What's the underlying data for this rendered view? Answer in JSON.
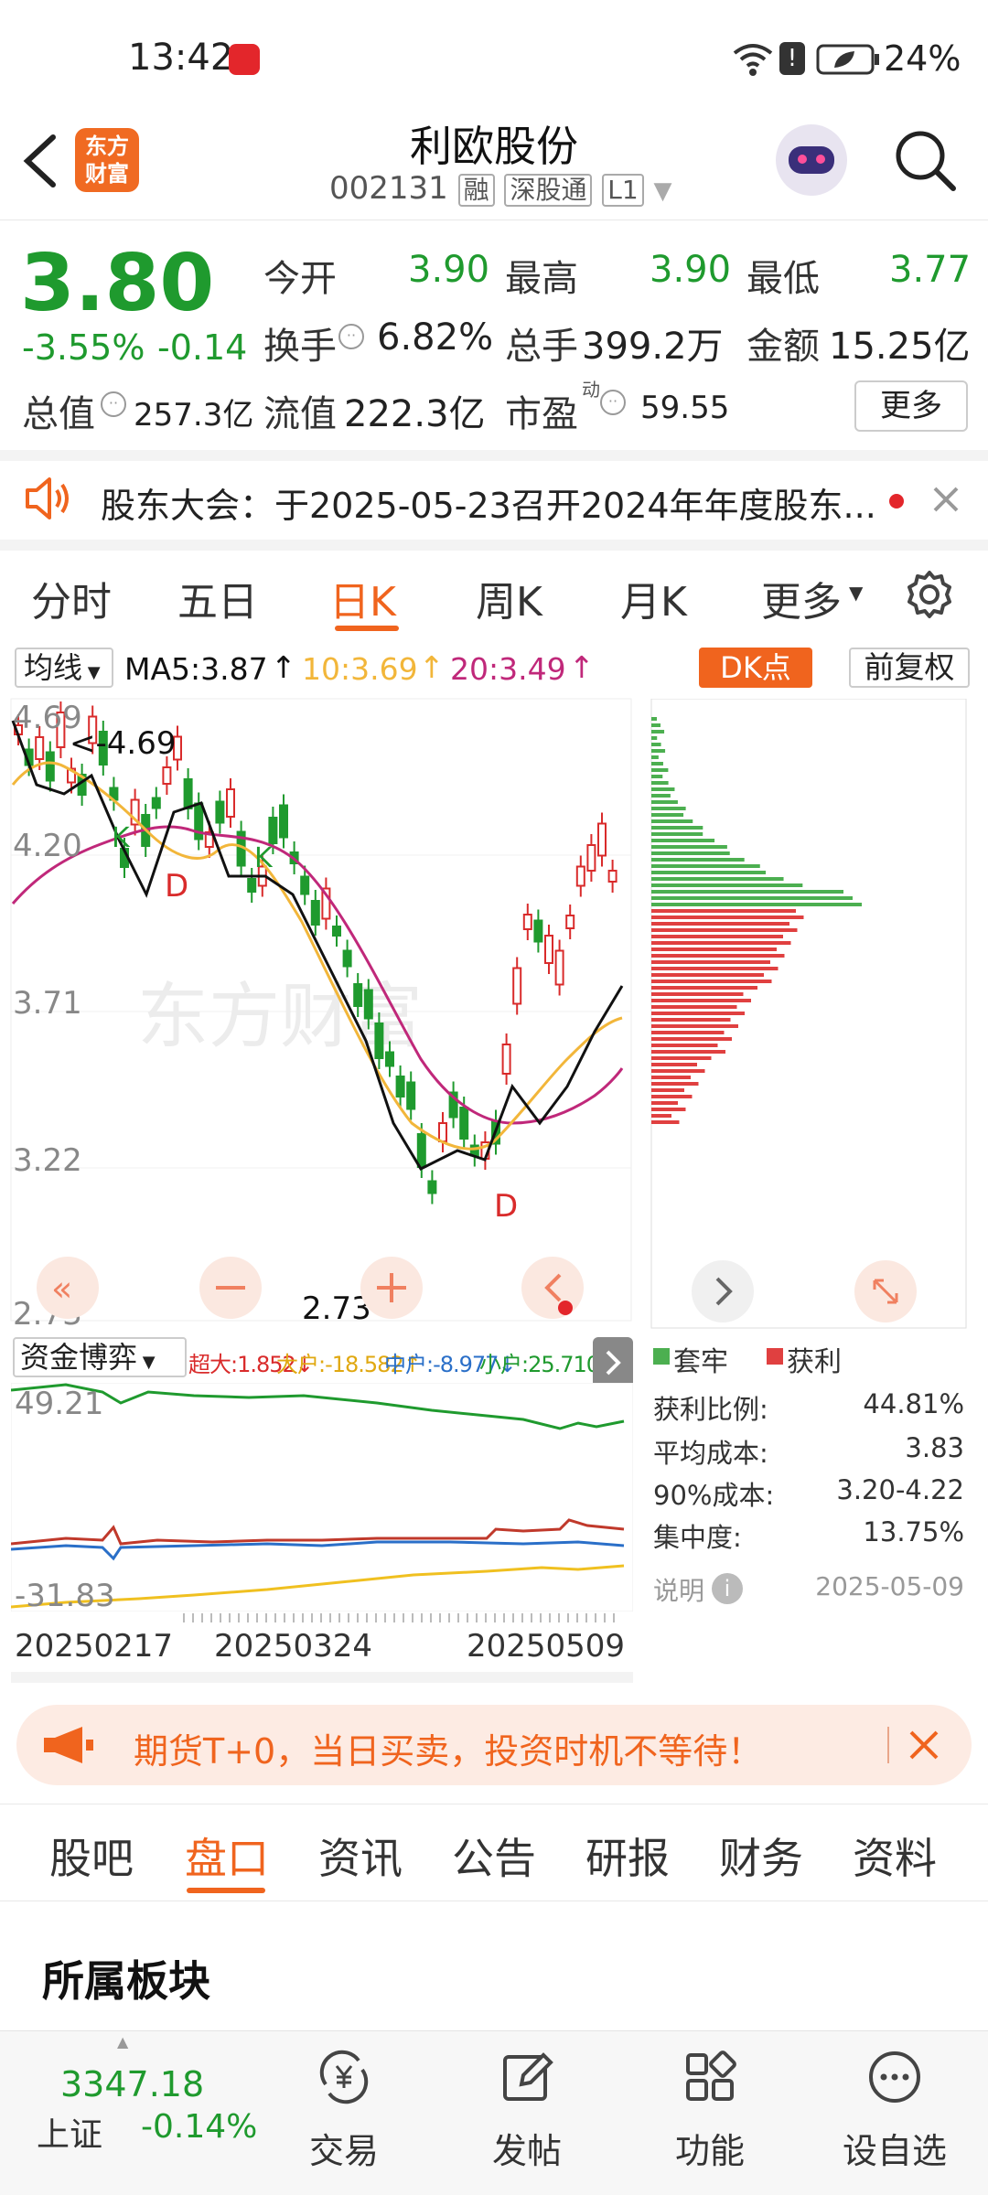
{
  "status_bar": {
    "time": "13:42",
    "battery": "24%"
  },
  "header": {
    "logo_line1": "东方",
    "logo_line2": "财富",
    "stock_name": "利欧股份",
    "stock_code": "002131",
    "tag_margin": "融",
    "tag_connect": "深股通",
    "tag_level": "L1"
  },
  "quote": {
    "price": "3.80",
    "change_pct": "-3.55%",
    "change_amt": "-0.14",
    "open_label": "今开",
    "open": "3.90",
    "high_label": "最高",
    "high": "3.90",
    "low_label": "最低",
    "low": "3.77",
    "turnover_label": "换手",
    "turnover": "6.82%",
    "volume_label": "总手",
    "volume": "399.2万",
    "amount_label": "金额",
    "amount": "15.25亿",
    "mcap_label": "总值",
    "mcap": "257.3亿",
    "float_label": "流值",
    "float_cap": "222.3亿",
    "pe_label": "市盈",
    "pe_sup": "动",
    "pe": "59.55",
    "more": "更多"
  },
  "notice": {
    "text": "股东大会：于2025-05-23召开2024年年度股东..."
  },
  "chart_tabs": [
    "分时",
    "五日",
    "日K",
    "周K",
    "月K",
    "更多"
  ],
  "chart_tabs_active": 2,
  "ma_bar": {
    "selector": "均线",
    "ma5": "MA5:3.87",
    "ma10": "10:3.69",
    "ma20": "20:3.49",
    "dk_button": "DK点",
    "adjust_button": "前复权"
  },
  "kline": {
    "y_labels": [
      "4.69",
      "4.20",
      "3.71",
      "3.22",
      "2.73"
    ],
    "high_marker": "<-4.69",
    "low_marker": "2.73->",
    "d_marker": "D",
    "k_marker": "K",
    "watermark": "东方财富",
    "colors": {
      "up": "#d92b2b",
      "down": "#1f9a2e",
      "ma5": "#111111",
      "ma10": "#f2b63a",
      "ma20": "#c0287a"
    }
  },
  "capital_flow": {
    "selector": "资金博弈",
    "super_large": "超大:1.852↓",
    "large": "大户:-18.582↑",
    "medium": "中户:-8.977↓",
    "small": "小户:25.710↑",
    "y_top": "49.21",
    "y_bottom": "-31.83",
    "dates": [
      "20250217",
      "20250324",
      "20250509"
    ]
  },
  "chip_dist": {
    "legend_trapped": "套牢",
    "legend_profit": "获利",
    "rows": [
      {
        "label": "获利比例:",
        "value": "44.81%"
      },
      {
        "label": "平均成本:",
        "value": "3.83"
      },
      {
        "label": "90%成本:",
        "value": "3.20-4.22"
      },
      {
        "label": "集中度:",
        "value": "13.75%"
      }
    ],
    "explain": "说明",
    "date": "2025-05-09"
  },
  "ad_banner": {
    "text": "期货T+0，当日买卖，投资时机不等待！"
  },
  "bottom_tabs": [
    "股吧",
    "盘口",
    "资讯",
    "公告",
    "研报",
    "财务",
    "资料"
  ],
  "bottom_tabs_active": 1,
  "section_title": "所属板块",
  "bottom_nav": {
    "index_value": "3347.18",
    "index_name": "上证",
    "index_change": "-0.14%",
    "trade": "交易",
    "post": "发帖",
    "function": "功能",
    "watchlist": "设自选"
  }
}
